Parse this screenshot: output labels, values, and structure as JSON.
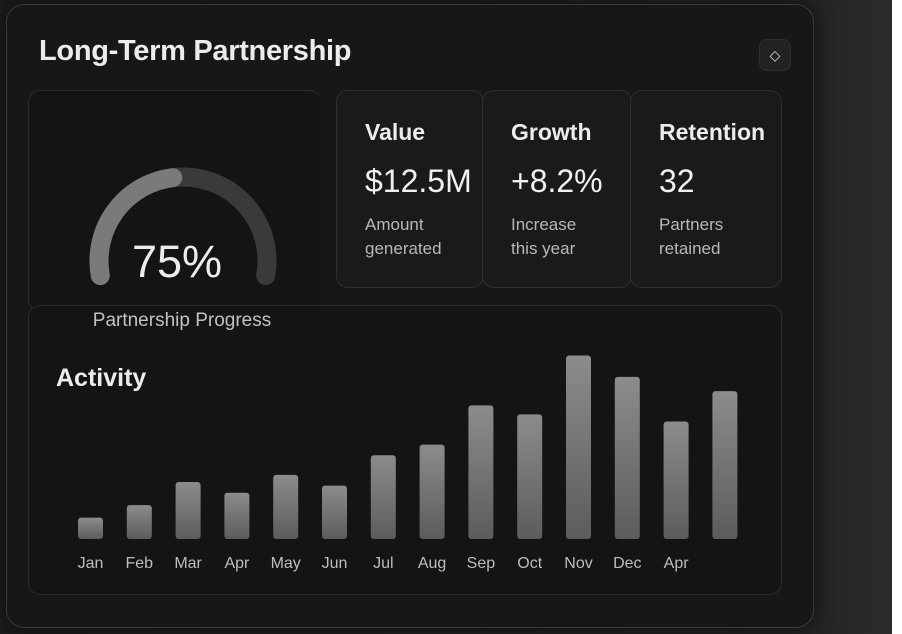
{
  "header": {
    "title": "Long-Term Partnership",
    "action_icon": "diamond-icon",
    "action_glyph": "◇"
  },
  "gauge": {
    "value_label": "75%",
    "progress": 0.75,
    "caption": "Partnership Progress"
  },
  "stats": [
    {
      "label": "Value",
      "value": "$12.5M",
      "description": "Amount\ngenerated"
    },
    {
      "label": "Growth",
      "value": "+8.2%",
      "description": "Increase\nthis year"
    },
    {
      "label": "Retention",
      "value": "32",
      "description": "Partners\nretained"
    }
  ],
  "activity": {
    "title": "Activity"
  },
  "chart_data": {
    "type": "bar",
    "categories": [
      "Jan",
      "Feb",
      "Mar",
      "Apr",
      "May",
      "Jun",
      "Jul",
      "Aug",
      "Sep",
      "Oct",
      "Nov",
      "Dec",
      "Apr"
    ],
    "values": [
      12,
      19,
      32,
      26,
      36,
      30,
      47,
      53,
      75,
      70,
      103,
      91,
      66,
      83
    ],
    "title": "Activity",
    "xlabel": "",
    "ylabel": "",
    "ylim": [
      0,
      105
    ],
    "grid": false,
    "legend": "none"
  },
  "colors": {
    "background": "#171717",
    "bar_top": "#8a8a8a",
    "bar_bottom": "#5a5a5a",
    "gauge_fill": "#7a7a7a",
    "gauge_track": "#3a3a3a"
  }
}
